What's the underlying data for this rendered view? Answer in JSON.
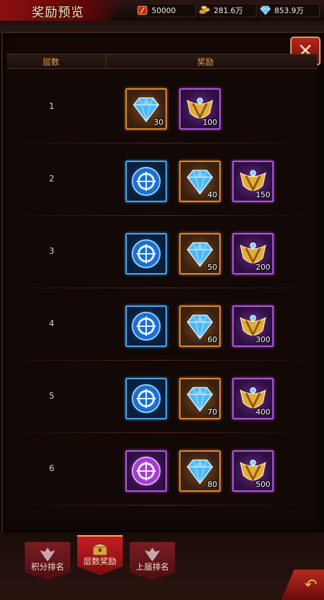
{
  "title": "奖励预览",
  "resources": [
    {
      "icon": "tear-card-icon",
      "value": "50000"
    },
    {
      "icon": "gold-coins-icon",
      "value": "281.6万"
    },
    {
      "icon": "diamond-icon",
      "value": "853.9万"
    }
  ],
  "table": {
    "col_level": "层数",
    "col_reward": "奖励"
  },
  "rows": [
    {
      "level": "1",
      "items": [
        {
          "icon": "diamond-icon",
          "quality": "orange",
          "count": "30"
        },
        {
          "icon": "gold-badge-icon",
          "quality": "purple",
          "count": "100"
        }
      ]
    },
    {
      "level": "2",
      "items": [
        {
          "icon": "blue-orb-icon",
          "quality": "blue",
          "count": ""
        },
        {
          "icon": "diamond-icon",
          "quality": "orange",
          "count": "40"
        },
        {
          "icon": "gold-badge-icon",
          "quality": "purple",
          "count": "150"
        }
      ]
    },
    {
      "level": "3",
      "items": [
        {
          "icon": "blue-orb-icon",
          "quality": "blue",
          "count": ""
        },
        {
          "icon": "diamond-icon",
          "quality": "orange",
          "count": "50"
        },
        {
          "icon": "gold-badge-icon",
          "quality": "purple",
          "count": "200"
        }
      ]
    },
    {
      "level": "4",
      "items": [
        {
          "icon": "blue-orb-icon",
          "quality": "blue",
          "count": ""
        },
        {
          "icon": "diamond-icon",
          "quality": "orange",
          "count": "60"
        },
        {
          "icon": "gold-badge-icon",
          "quality": "purple",
          "count": "300"
        }
      ]
    },
    {
      "level": "5",
      "items": [
        {
          "icon": "blue-orb-icon",
          "quality": "blue",
          "count": ""
        },
        {
          "icon": "diamond-icon",
          "quality": "orange",
          "count": "70"
        },
        {
          "icon": "gold-badge-icon",
          "quality": "purple",
          "count": "400"
        }
      ]
    },
    {
      "level": "6",
      "items": [
        {
          "icon": "purple-orb-icon",
          "quality": "violet",
          "count": ""
        },
        {
          "icon": "diamond-icon",
          "quality": "orange",
          "count": "80"
        },
        {
          "icon": "gold-badge-icon",
          "quality": "purple",
          "count": "500"
        }
      ]
    }
  ],
  "tabs": [
    {
      "label": "积分排名",
      "active": false
    },
    {
      "label": "层数奖励",
      "active": true
    },
    {
      "label": "上届排名",
      "active": false
    }
  ],
  "colors": {
    "header_text": "#e6a256",
    "title_text": "#f4e7c4",
    "accent_red": "#8b0f10"
  }
}
